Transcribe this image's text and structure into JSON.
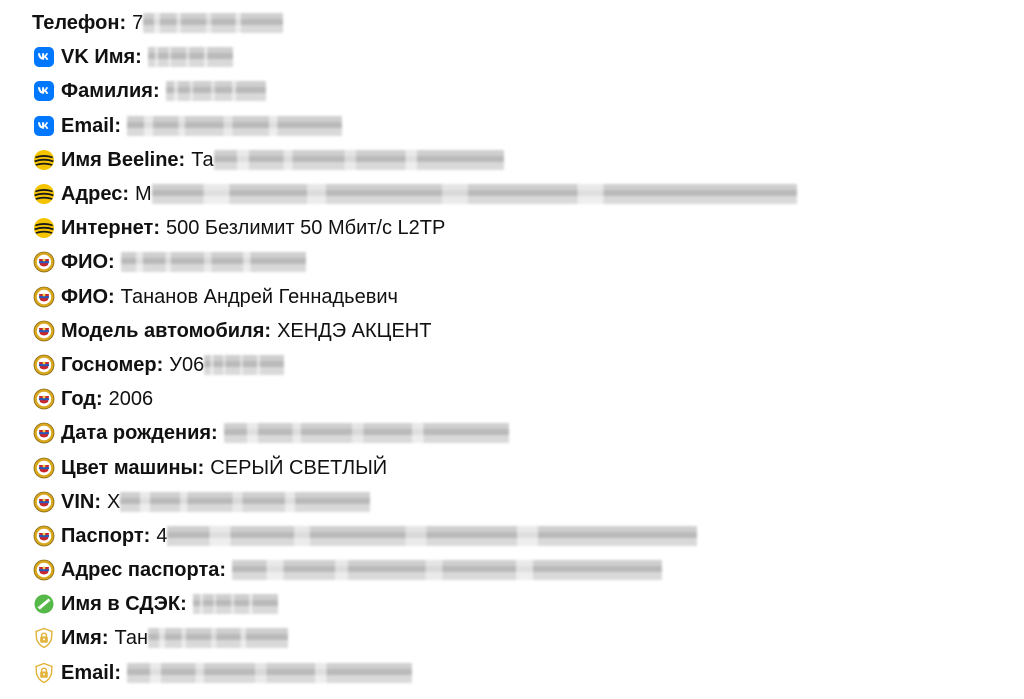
{
  "rows": [
    {
      "icon": "none",
      "label": "Телефон:",
      "value": "7",
      "blur_w": 140
    },
    {
      "icon": "vk-icon",
      "label": "VK Имя:",
      "value": "",
      "blur_w": 85
    },
    {
      "icon": "vk-icon",
      "label": "Фамилия:",
      "value": "",
      "blur_w": 100
    },
    {
      "icon": "vk-icon",
      "label": "Email:",
      "value": "",
      "blur_w": 215
    },
    {
      "icon": "beeline-icon",
      "label": "Имя Beeline:",
      "value": "Та",
      "blur_w": 290
    },
    {
      "icon": "beeline-icon",
      "label": "Адрес:",
      "value": "М",
      "blur_w": 645
    },
    {
      "icon": "beeline-icon",
      "label": "Интернет:",
      "value": "500 Безлимит 50 Мбит/с L2TP",
      "blur_w": 0
    },
    {
      "icon": "gibdd-icon",
      "label": "ФИО:",
      "value": "",
      "blur_w": 185
    },
    {
      "icon": "gibdd-icon",
      "label": "ФИО:",
      "value": "Тананов Андрей Геннадьевич",
      "blur_w": 0
    },
    {
      "icon": "gibdd-icon",
      "label": "Модель автомобиля:",
      "value": "ХЕНДЭ АКЦЕНТ",
      "blur_w": 0
    },
    {
      "icon": "gibdd-icon",
      "label": "Госномер:",
      "value": "У06",
      "blur_w": 80
    },
    {
      "icon": "gibdd-icon",
      "label": "Год:",
      "value": "2006",
      "blur_w": 0
    },
    {
      "icon": "gibdd-icon",
      "label": "Дата рождения:",
      "value": "",
      "blur_w": 285
    },
    {
      "icon": "gibdd-icon",
      "label": "Цвет машины:",
      "value": "СЕРЫЙ СВЕТЛЫЙ",
      "blur_w": 0
    },
    {
      "icon": "gibdd-icon",
      "label": "VIN:",
      "value": "Х",
      "blur_w": 250
    },
    {
      "icon": "gibdd-icon",
      "label": "Паспорт:",
      "value": "4",
      "blur_w": 530
    },
    {
      "icon": "gibdd-icon",
      "label": "Адрес паспорта:",
      "value": "",
      "blur_w": 430
    },
    {
      "icon": "cdek-icon",
      "label": "Имя в СДЭК:",
      "value": "",
      "blur_w": 85
    },
    {
      "icon": "lock-shield-icon",
      "label": "Имя:",
      "value": "Тан",
      "blur_w": 140
    },
    {
      "icon": "lock-shield-icon",
      "label": "Email:",
      "value": "",
      "blur_w": 285
    }
  ],
  "colors": {
    "vk": "#0077ff",
    "beeline_yellow": "#f5c400",
    "beeline_black": "#1a1a1a",
    "gibdd_gold": "#d8a71e",
    "gibdd_red": "#c8262c",
    "gibdd_blue": "#2b57b8",
    "cdek_green": "#55b848",
    "lock_gold": "#e2b23a"
  }
}
